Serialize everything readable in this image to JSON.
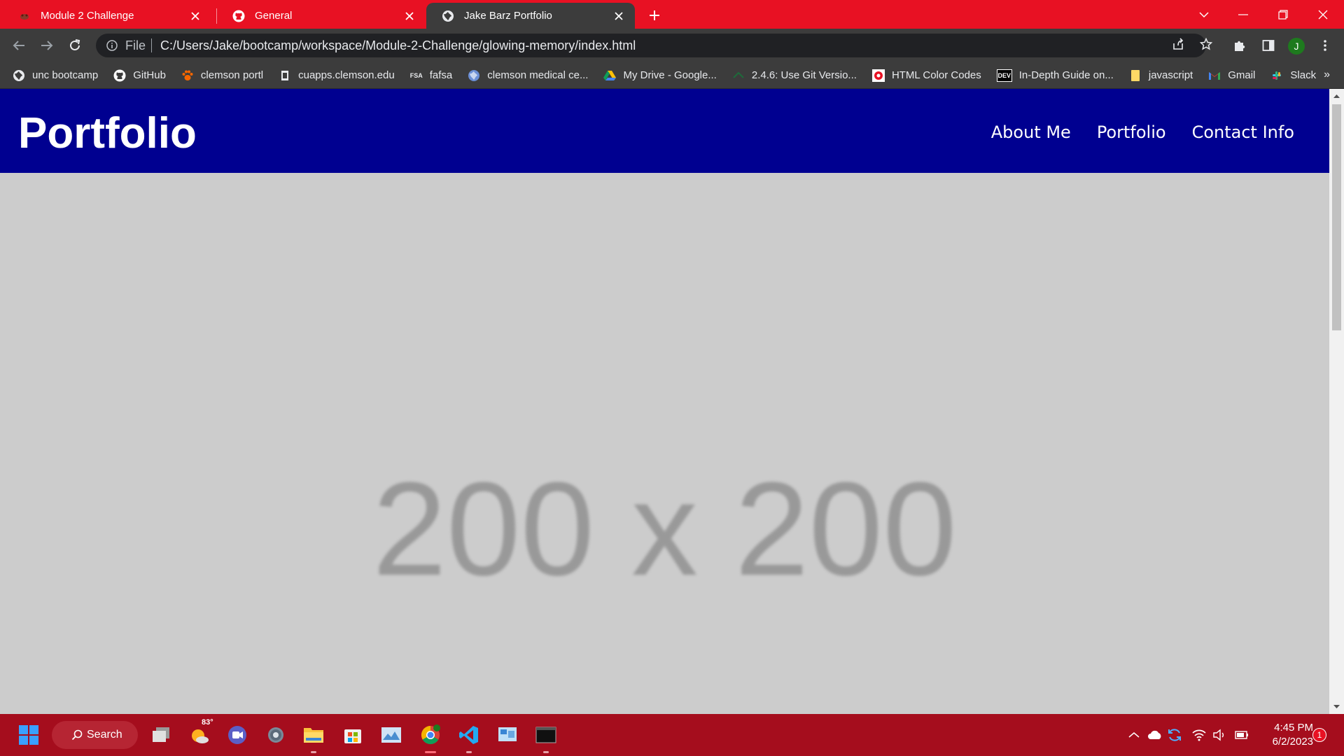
{
  "browser": {
    "tabs": [
      {
        "title": "Module 2 Challenge",
        "icon": "module-favicon"
      },
      {
        "title": "General",
        "icon": "github-icon"
      },
      {
        "title": "Jake Barz Portfolio",
        "icon": "globe-icon",
        "active": true
      }
    ],
    "omnibox": {
      "scheme_label": "File",
      "url": "C:/Users/Jake/bootcamp/workspace/Module-2-Challenge/glowing-memory/index.html"
    },
    "profile_initial": "J",
    "bookmarks": [
      {
        "label": "unc bootcamp",
        "icon": "globe-icon"
      },
      {
        "label": "GitHub",
        "icon": "github-icon"
      },
      {
        "label": "clemson portl",
        "icon": "paw-icon"
      },
      {
        "label": "cuapps.clemson.edu",
        "icon": "page-icon"
      },
      {
        "label": "fafsa",
        "icon": "fsa-icon",
        "icon_text": "FSA"
      },
      {
        "label": "clemson medical ce...",
        "icon": "globe-icon"
      },
      {
        "label": "My Drive - Google...",
        "icon": "drive-icon"
      },
      {
        "label": "2.4.6: Use Git Versio...",
        "icon": "course-icon"
      },
      {
        "label": "HTML Color Codes",
        "icon": "color-icon"
      },
      {
        "label": "In-Depth Guide on...",
        "icon": "dev-icon",
        "icon_text": "DEV"
      },
      {
        "label": "javascript",
        "icon": "folder-icon"
      },
      {
        "label": "Gmail",
        "icon": "gmail-icon"
      },
      {
        "label": "Slack",
        "icon": "slack-icon"
      }
    ],
    "bookmarks_overflow": "»"
  },
  "page": {
    "site_title": "Portfolio",
    "nav": [
      "About Me",
      "Portfolio",
      "Contact Info"
    ],
    "placeholder_text": "200 x 200",
    "colors": {
      "header_bg": "#000090",
      "body_bg": "#cccccc",
      "placeholder_text": "#999999"
    }
  },
  "taskbar": {
    "search_label": "Search",
    "weather_temp": "83°",
    "time": "4:45 PM",
    "date": "6/2/2023",
    "notification_count": "1"
  },
  "colors": {
    "tabstrip": "#e81123",
    "taskbar": "#a50d1d",
    "toolbar": "#3c3c3c"
  }
}
